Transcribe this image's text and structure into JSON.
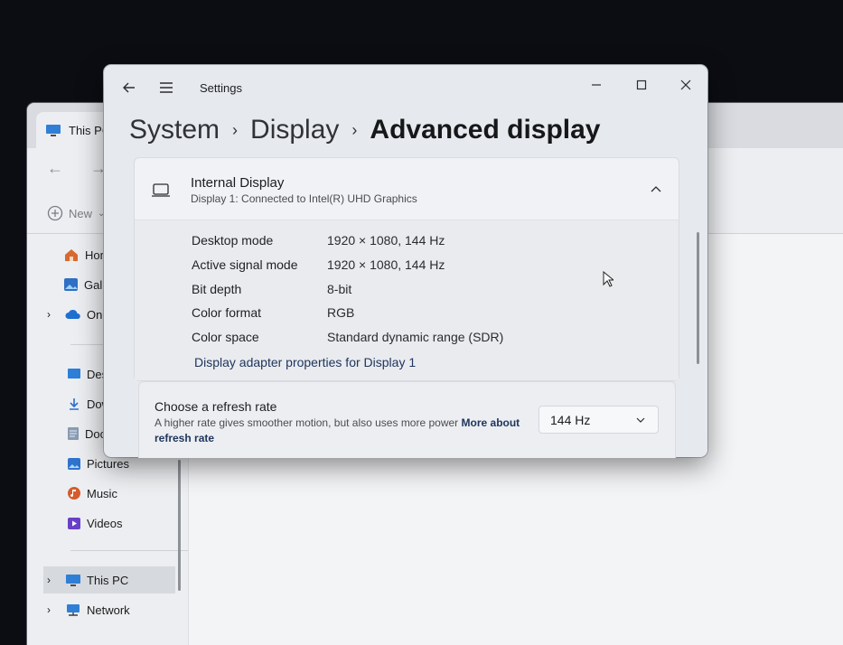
{
  "explorer": {
    "tab_title": "This PC",
    "command_new": "New",
    "nav": {
      "home": "Home",
      "gallery": "Gallery",
      "onedrive": "OneDrive",
      "desktop": "Desktop",
      "downloads": "Downloads",
      "documents": "Documents",
      "pictures": "Pictures",
      "music": "Music",
      "videos": "Videos",
      "this_pc": "This PC",
      "network": "Network"
    }
  },
  "settings": {
    "window_title": "Settings",
    "breadcrumb": {
      "level1": "System",
      "level2": "Display",
      "current": "Advanced display",
      "separator": "›"
    },
    "display_card": {
      "title": "Internal Display",
      "subtitle": "Display 1: Connected to Intel(R) UHD Graphics",
      "rows": [
        {
          "label": "Desktop mode",
          "value": "1920 × 1080, 144 Hz"
        },
        {
          "label": "Active signal mode",
          "value": "1920 × 1080, 144 Hz"
        },
        {
          "label": "Bit depth",
          "value": "8-bit"
        },
        {
          "label": "Color format",
          "value": "RGB"
        },
        {
          "label": "Color space",
          "value": "Standard dynamic range (SDR)"
        }
      ],
      "adapter_link": "Display adapter properties for Display 1"
    },
    "refresh": {
      "title": "Choose a refresh rate",
      "description": "A higher rate gives smoother motion, but also uses more power",
      "link": "More about refresh rate",
      "selected_rate": "144 Hz"
    }
  },
  "colors": {
    "link": "#20365c",
    "settings_bg": "#e6e9ee",
    "screen_bg": "#0b0d12"
  }
}
